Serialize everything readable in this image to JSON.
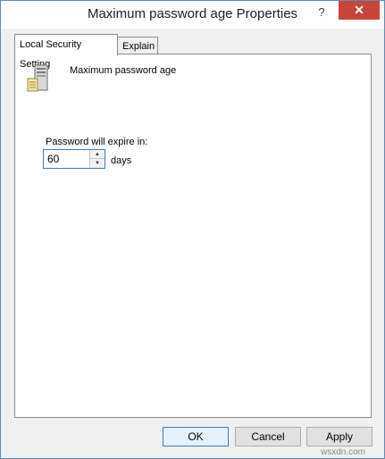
{
  "window": {
    "title": "Maximum password age Properties",
    "help_glyph": "?",
    "close_glyph": "✕"
  },
  "tabs": [
    {
      "label": "Local Security Setting",
      "active": true
    },
    {
      "label": "Explain",
      "active": false
    }
  ],
  "setting": {
    "icon": "server-icon",
    "policy_name": "Maximum password age",
    "expire_label": "Password will expire in:",
    "value": "60",
    "unit": "days"
  },
  "buttons": {
    "ok": "OK",
    "cancel": "Cancel",
    "apply": "Apply"
  },
  "watermark": "wsxdn.com",
  "colors": {
    "close_button": "#c7443a",
    "focus_border": "#3c7fb1"
  }
}
